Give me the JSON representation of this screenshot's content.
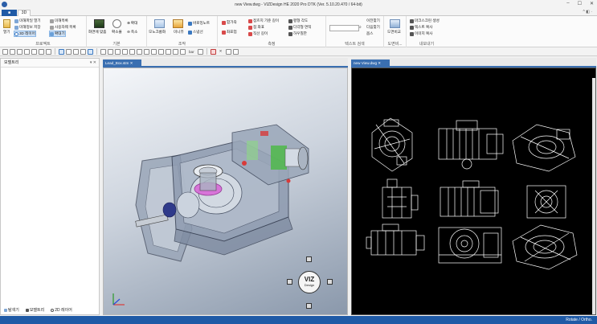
{
  "window": {
    "title": "new View.dwg - VIZDesign HE 2020 Pro DTK (Ver. 5.10.20.470 / 64-bit)",
    "minimize_glyph": "–",
    "maximize_glyph": "☐",
    "close_glyph": "✕"
  },
  "tabs": {
    "file": "■",
    "active": "3D",
    "right": "^ ◧ ·"
  },
  "ribbon": {
    "groups": {
      "project": "프로젝트",
      "basic": "기본",
      "view": "조작",
      "measure": "측정",
      "text_search": "텍스트 검색",
      "drawing": "도면비...",
      "export": "내보내기"
    },
    "open_label": "열기",
    "project_items": [
      "미해파일 열기",
      "미해정보 저장",
      "3D 레이어",
      "미해목록",
      "사용자웨 목록",
      "확대기"
    ],
    "basic_items": [
      "화면에 맞춤",
      "확소율"
    ],
    "zoom_items": [
      "확대",
      "축소"
    ],
    "view_items": [
      "모노크롬화",
      "미니뷰",
      "바로잉노트",
      "스냅선"
    ],
    "measure_items": [
      "함가죽",
      "좌표업",
      "점흐지 기준 길이",
      "점 좌표",
      "직선 길이",
      "평형 각도",
      "다각형 면적",
      "하우칠한"
    ],
    "search_placeholder": "",
    "search_items": [
      "이전찾기",
      "다음찾기",
      "옵스"
    ],
    "drawing_items": [
      "도면비교"
    ],
    "export_items": [
      "마크스크린 생성",
      "텍스트 복사",
      "이미지 복사"
    ]
  },
  "toolbar": {
    "bar_label": "bar",
    "x_label": "✕"
  },
  "left_panel": {
    "title": "모델트리",
    "pin": "▾ ✕",
    "bottom_tabs": [
      "탐색기",
      "모델트리",
      "2D 레이어"
    ]
  },
  "docs": [
    {
      "tab": "Lead_Box.stm  ✕"
    },
    {
      "tab": "new View.dwg  ✕"
    }
  ],
  "viz_badge": {
    "line1": "VIZ",
    "line2": "Design"
  },
  "status": {
    "right": "Rotate / Ortho."
  },
  "colors": {
    "accent": "#1f5aa6",
    "cad_bg": "#000000",
    "cad_line": "#ffffff"
  }
}
